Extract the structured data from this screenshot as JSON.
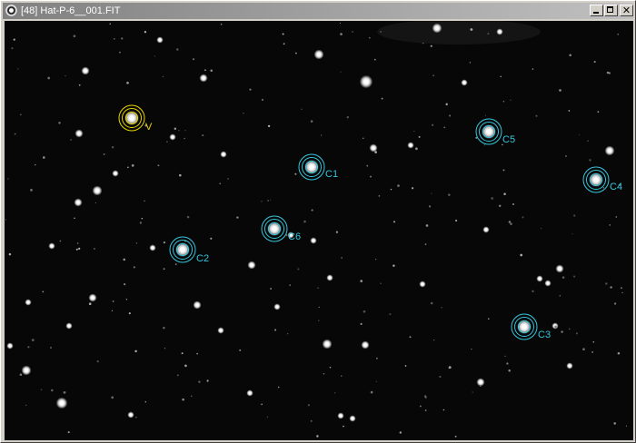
{
  "window": {
    "title": "[48] Hat-P-6__001.FIT",
    "controls": {
      "minimize_icon": "minimize-icon",
      "maximize_icon": "maximize-icon",
      "close_icon": "close-icon"
    }
  },
  "image": {
    "background_color": "#070707",
    "star_color": "#ffffff"
  },
  "apertures": [
    {
      "id": "target",
      "label": "V",
      "color": "#e8d300"
    },
    {
      "id": "c1",
      "label": "C1",
      "color": "#35c6dd"
    },
    {
      "id": "c2",
      "label": "C2",
      "color": "#35c6dd"
    },
    {
      "id": "c3",
      "label": "C3",
      "color": "#35c6dd"
    },
    {
      "id": "c4",
      "label": "C4",
      "color": "#35c6dd"
    },
    {
      "id": "c5",
      "label": "C5",
      "color": "#35c6dd"
    },
    {
      "id": "c6",
      "label": "C6",
      "color": "#35c6dd"
    }
  ]
}
